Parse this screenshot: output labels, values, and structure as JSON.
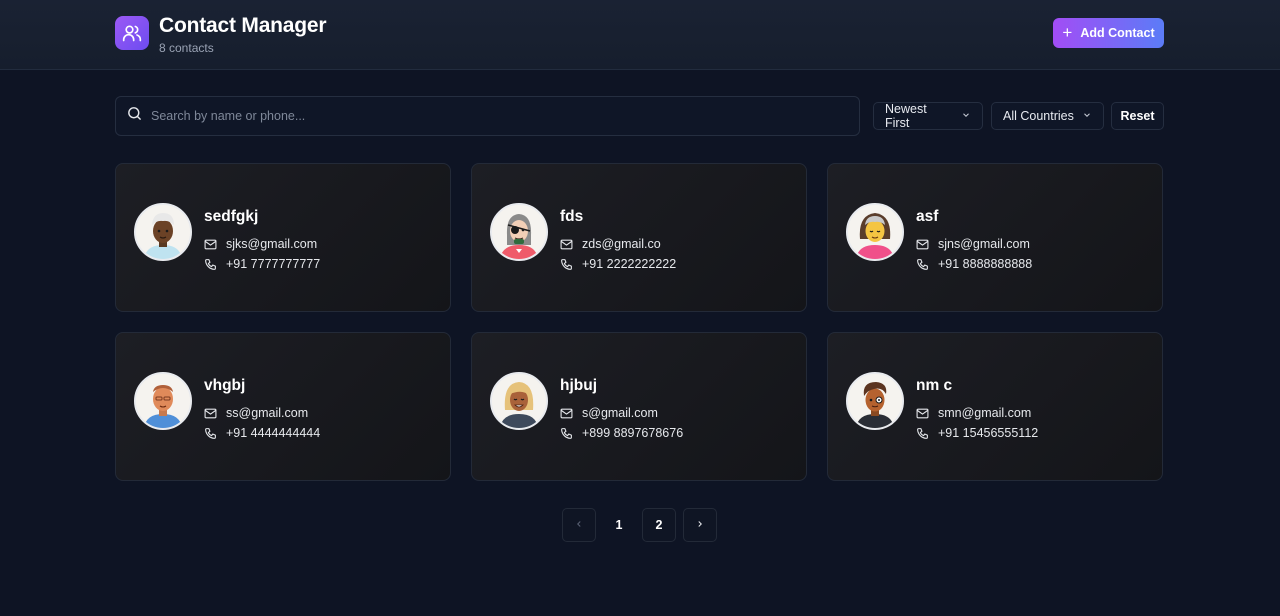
{
  "header": {
    "title": "Contact Manager",
    "subtitle": "8 contacts",
    "add_button_label": "Add Contact",
    "accent_from": "#a24df5",
    "accent_to": "#5b7cf7"
  },
  "toolbar": {
    "search_placeholder": "Search by name or phone...",
    "sort_selected": "Newest First",
    "country_selected": "All Countries",
    "reset_label": "Reset"
  },
  "contacts": [
    {
      "name": "sedfgkj",
      "email": "sjks@gmail.com",
      "phone": "+91 7777777777",
      "avatar_icon": "avatar-white-hair-icon"
    },
    {
      "name": "fds",
      "email": "zds@gmail.co",
      "phone": "+91 2222222222",
      "avatar_icon": "avatar-eyepatch-icon"
    },
    {
      "name": "asf",
      "email": "sjns@gmail.com",
      "phone": "+91 8888888888",
      "avatar_icon": "avatar-grey-hair-icon"
    },
    {
      "name": "vhgbj",
      "email": "ss@gmail.com",
      "phone": "+91 4444444444",
      "avatar_icon": "avatar-bald-icon"
    },
    {
      "name": "hjbuj",
      "email": "s@gmail.com",
      "phone": "+899 8897678676",
      "avatar_icon": "avatar-blonde-icon"
    },
    {
      "name": "nm c",
      "email": "smn@gmail.com",
      "phone": "+91 15456555112",
      "avatar_icon": "avatar-monocle-icon"
    }
  ],
  "pagination": {
    "pages": [
      "1",
      "2"
    ],
    "current": "2"
  }
}
